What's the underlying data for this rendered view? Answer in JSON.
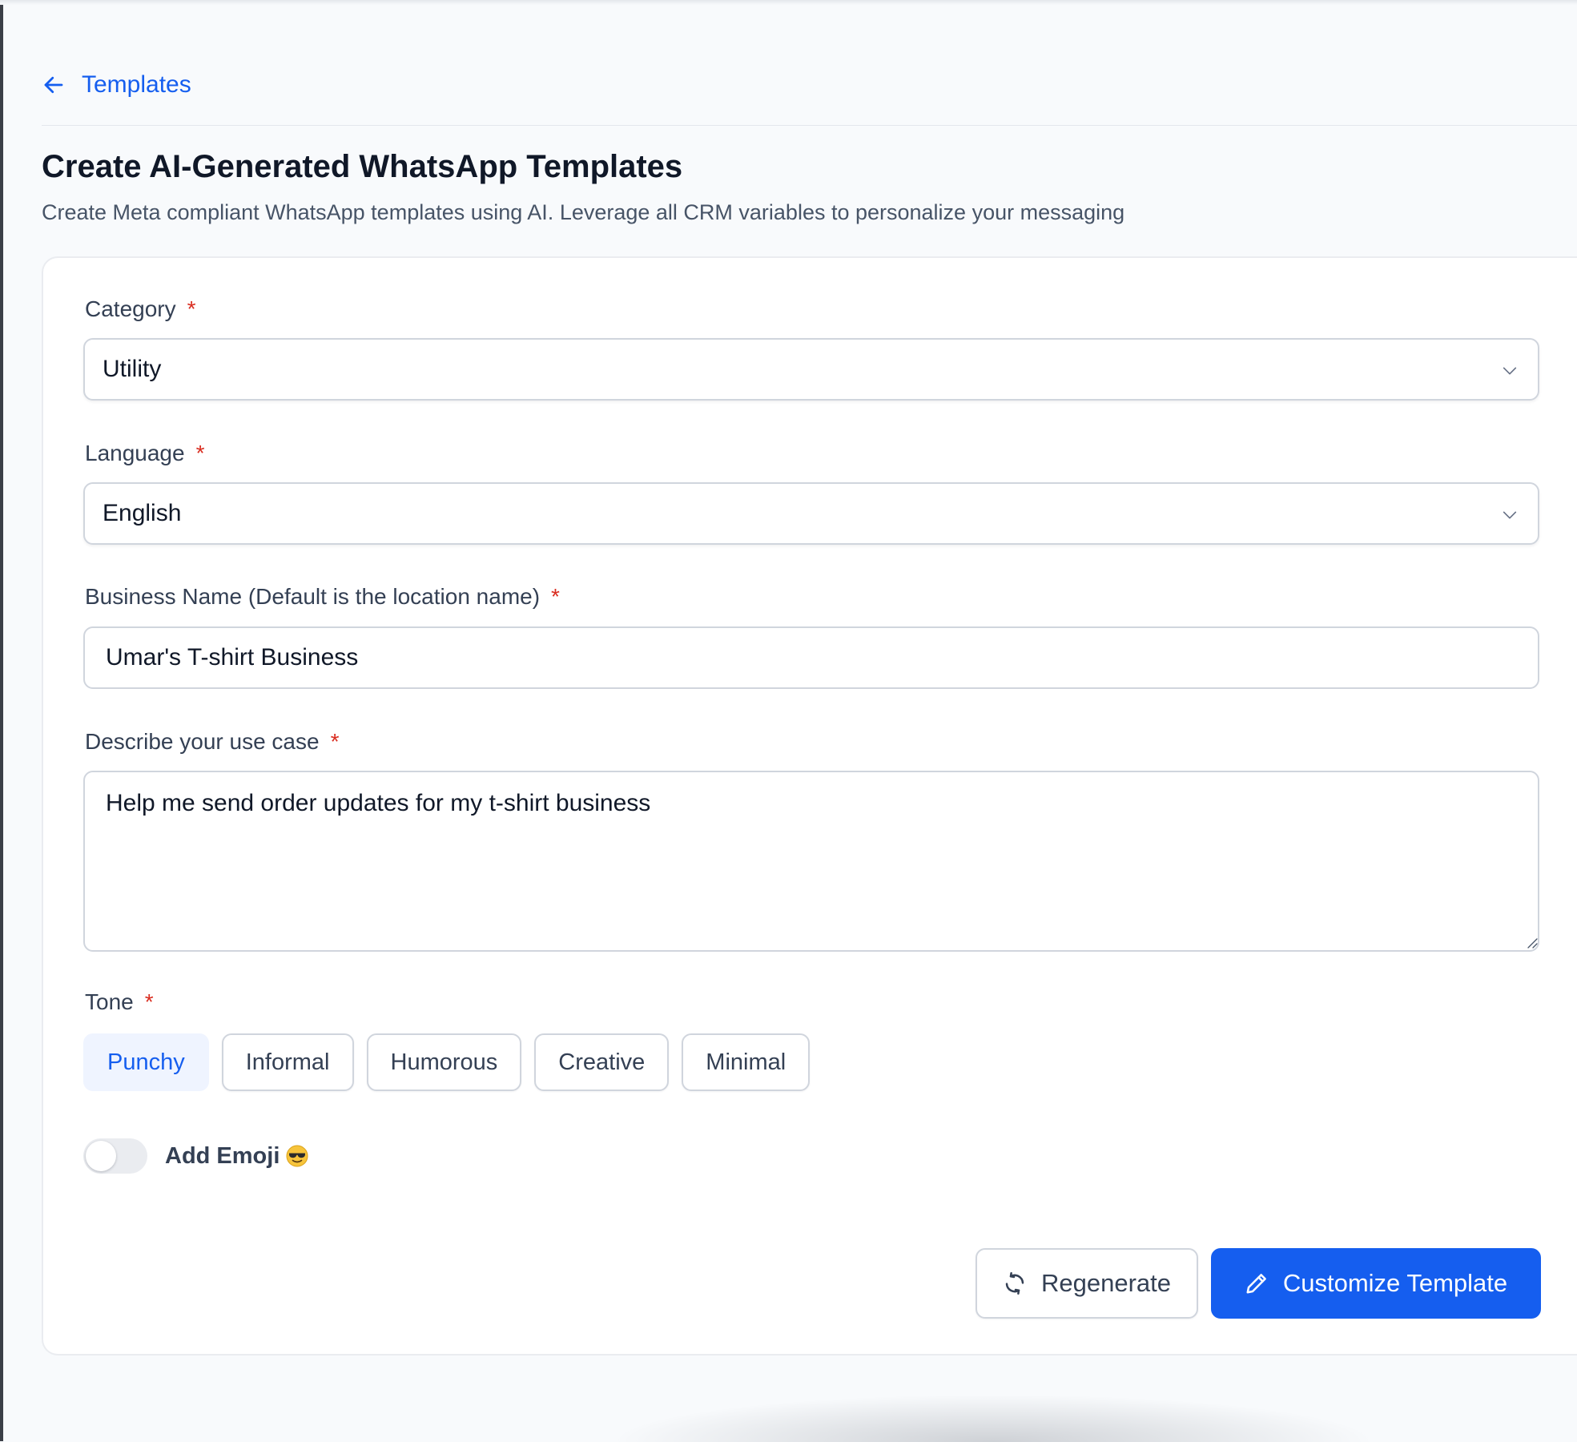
{
  "nav": {
    "back_label": "Templates"
  },
  "header": {
    "title": "Create AI-Generated WhatsApp Templates",
    "subtitle": "Create Meta compliant WhatsApp templates using AI. Leverage all CRM variables to personalize your messaging"
  },
  "form": {
    "required_marker": "*",
    "category": {
      "label": "Category",
      "value": "Utility"
    },
    "language": {
      "label": "Language",
      "value": "English"
    },
    "business_name": {
      "label": "Business Name (Default is the location name)",
      "value": "Umar's T-shirt Business"
    },
    "use_case": {
      "label": "Describe your use case",
      "value": "Help me send order updates for my t-shirt business"
    },
    "tone": {
      "label": "Tone",
      "options": [
        "Punchy",
        "Informal",
        "Humorous",
        "Creative",
        "Minimal"
      ],
      "selected": "Punchy"
    },
    "emoji_toggle": {
      "label": "Add Emoji",
      "enabled": false,
      "icon": "sunglasses-emoji-icon"
    }
  },
  "actions": {
    "regenerate_label": "Regenerate",
    "customize_label": "Customize Template"
  },
  "colors": {
    "primary": "#155eef",
    "required": "#d92d20",
    "selected_bg": "#eff4ff",
    "border": "#d0d5dd"
  }
}
